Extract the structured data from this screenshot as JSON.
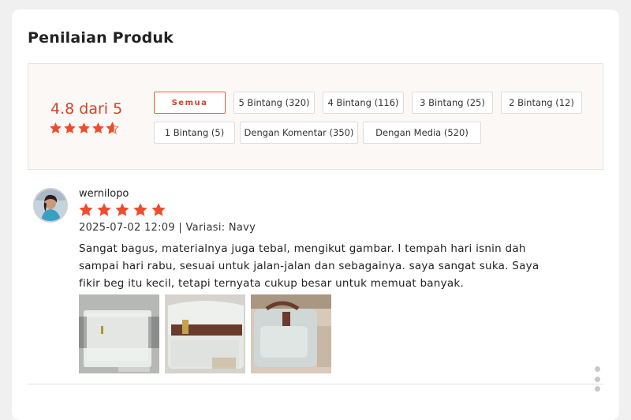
{
  "section_title": "Penilaian Produk",
  "summary": {
    "rating_text": "4.8 dari 5",
    "rating_value": 4.8,
    "rating_max": 5,
    "filters": [
      {
        "label": "Semua",
        "active": true
      },
      {
        "label": "5 Bintang (320)",
        "active": false
      },
      {
        "label": "4 Bintang (116)",
        "active": false
      },
      {
        "label": "3 Bintang (25)",
        "active": false
      },
      {
        "label": "2 Bintang (12)",
        "active": false
      },
      {
        "label": "1 Bintang (5)",
        "active": false
      },
      {
        "label": "Dengan Komentar (350)",
        "active": false
      },
      {
        "label": "Dengan Media (520)",
        "active": false
      }
    ]
  },
  "review": {
    "username": "wernilopo",
    "stars": 5,
    "meta": "2025-07-02 12:09 | Variasi: Navy",
    "text": "Sangat bagus, materialnya juga tebal, mengikut gambar. I tempah hari isnin dah sampai hari rabu, sesuai untuk jalan-jalan dan sebagainya. saya sangat suka. Saya fikir beg itu kecil, tetapi ternyata cukup besar untuk memuat banyak.",
    "photos": [
      "bag-photo-1",
      "bag-photo-2",
      "bag-photo-3"
    ]
  },
  "colors": {
    "accent": "#ee4d2d",
    "rating_text": "#d0452a",
    "summary_bg": "#fcf8f5"
  },
  "icons": {
    "star": "star-icon",
    "more": "more-vertical-icon"
  }
}
